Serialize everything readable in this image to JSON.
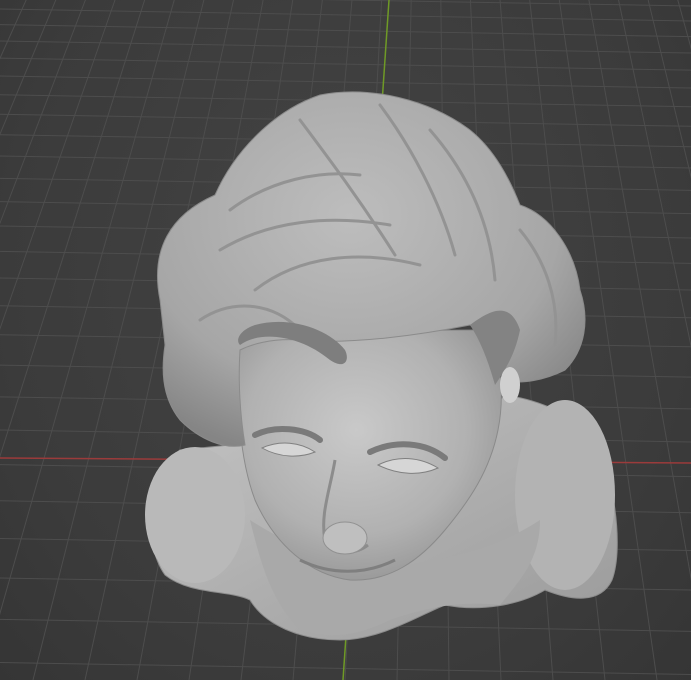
{
  "app": "3D viewport",
  "viewport": {
    "background_color": "#3d3d3d",
    "grid_color": "#4d4d4d",
    "x_axis_color": "#9b3b3b",
    "y_axis_color": "#6f9a26"
  },
  "scene": {
    "object": "sculpted-bust",
    "shading": "solid-matcap-gray",
    "object_color": "#b4b4b4",
    "parts": [
      "hair",
      "face",
      "shoulders",
      "neck-drape"
    ]
  }
}
